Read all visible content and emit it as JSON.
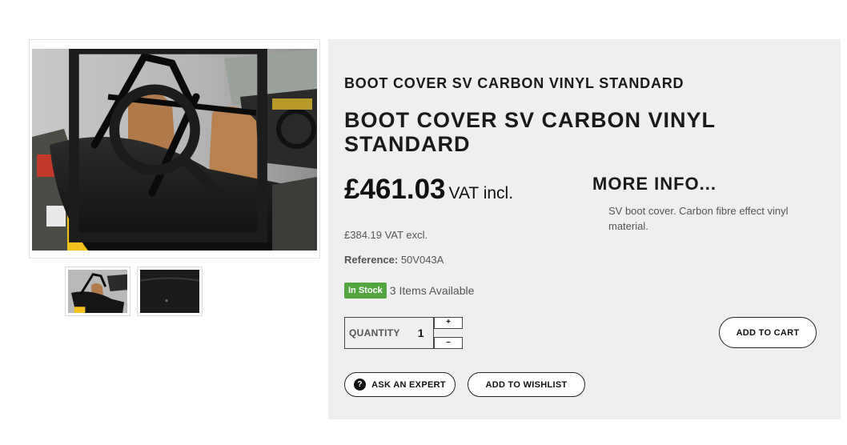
{
  "gallery": {
    "main_image_alt": "Boot cover on car rear",
    "thumbnails": [
      "Boot cover on car",
      "Boot cover close-up"
    ]
  },
  "product": {
    "breadcrumb_title": "BOOT COVER SV CARBON VINYL STANDARD",
    "title": "BOOT COVER SV CARBON VINYL STANDARD",
    "price": "£461.03",
    "price_suffix": "VAT incl.",
    "price_excl": "£384.19 VAT excl.",
    "reference_label": "Reference:",
    "reference_value": "50V043A",
    "stock_badge": "In Stock",
    "stock_count": "3 Items Available"
  },
  "quantity": {
    "label": "QUANTITY",
    "value": "1",
    "plus": "+",
    "minus": "–"
  },
  "actions": {
    "add_to_cart": "ADD TO CART",
    "ask_expert": "ASK AN EXPERT",
    "add_to_wishlist": "ADD TO WISHLIST",
    "help_icon_glyph": "?"
  },
  "more_info": {
    "title": "MORE INFO...",
    "text": "SV boot cover. Carbon fibre effect vinyl material."
  },
  "colors": {
    "panel_bg": "#efefef",
    "in_stock_green": "#52a53f",
    "text_dark": "#1a1a1a",
    "text_muted": "#555555"
  }
}
